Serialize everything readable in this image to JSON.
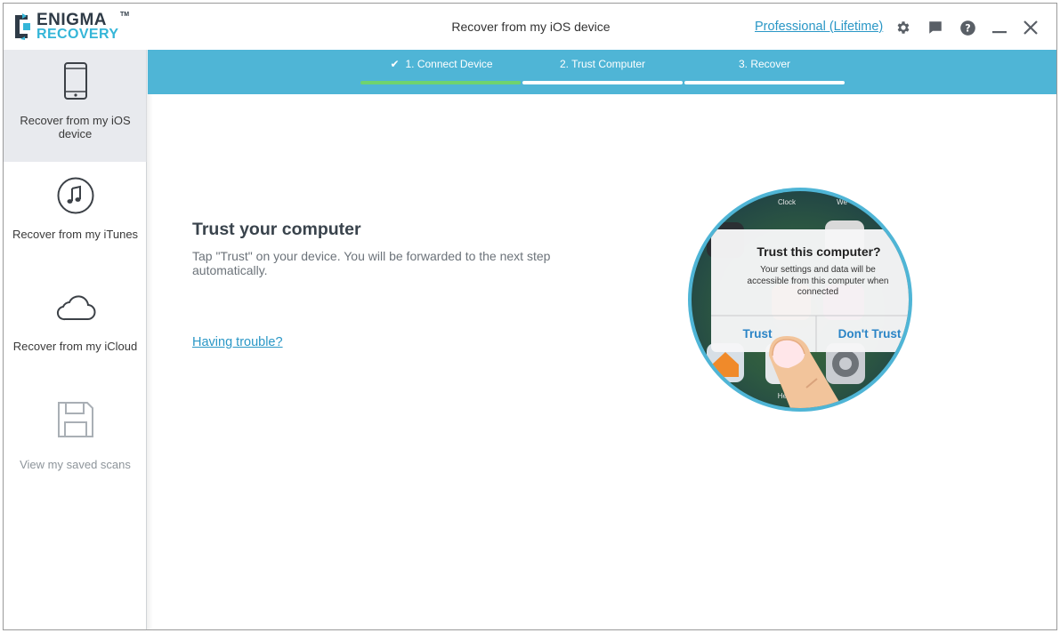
{
  "app": {
    "logo_top": "ENIGMA",
    "logo_tm": "TM",
    "logo_bottom": "RECOVERY",
    "window_title": "Recover from my iOS device",
    "license_link": "Professional (Lifetime)",
    "toolbar_icons": [
      "settings-gear-icon",
      "feedback-chat-icon",
      "help-icon",
      "minimize-icon",
      "close-icon"
    ]
  },
  "sidebar": {
    "items": [
      {
        "label": "Recover from my iOS device",
        "icon": "phone-icon",
        "active": true
      },
      {
        "label": "Recover from my iTunes",
        "icon": "music-note-icon",
        "active": false
      },
      {
        "label": "Recover from my iCloud",
        "icon": "cloud-icon",
        "active": false
      },
      {
        "label": "View my saved scans",
        "icon": "floppy-disk-icon",
        "active": false,
        "disabled": true
      }
    ]
  },
  "steps": [
    {
      "label": "1. Connect Device",
      "check": "✔",
      "status": "done"
    },
    {
      "label": "2. Trust Computer",
      "status": "current"
    },
    {
      "label": "3. Recover",
      "status": "pending"
    }
  ],
  "main": {
    "title": "Trust your computer",
    "description": "Tap \"Trust\" on your device. You will be forwarded to the next step automatically.",
    "trouble_link": "Having trouble?"
  },
  "illustration": {
    "dialog_title": "Trust this computer?",
    "dialog_body_1": "Your settings and  data will be",
    "dialog_body_2": "accessible from this computer when",
    "dialog_body_3": "connected",
    "trust_label": "Trust",
    "dont_trust_label": "Don't Trust",
    "bg_label_clock": "Clock",
    "bg_label_we": "We",
    "bg_label_heal": "Heal"
  },
  "colors": {
    "accent": "#4fb5d6",
    "step_done": "#6fd36e",
    "link": "#2a97c6",
    "logo_dark": "#2f3b47",
    "logo_blue": "#35b6d8",
    "ios_blue": "#2a84c6"
  }
}
